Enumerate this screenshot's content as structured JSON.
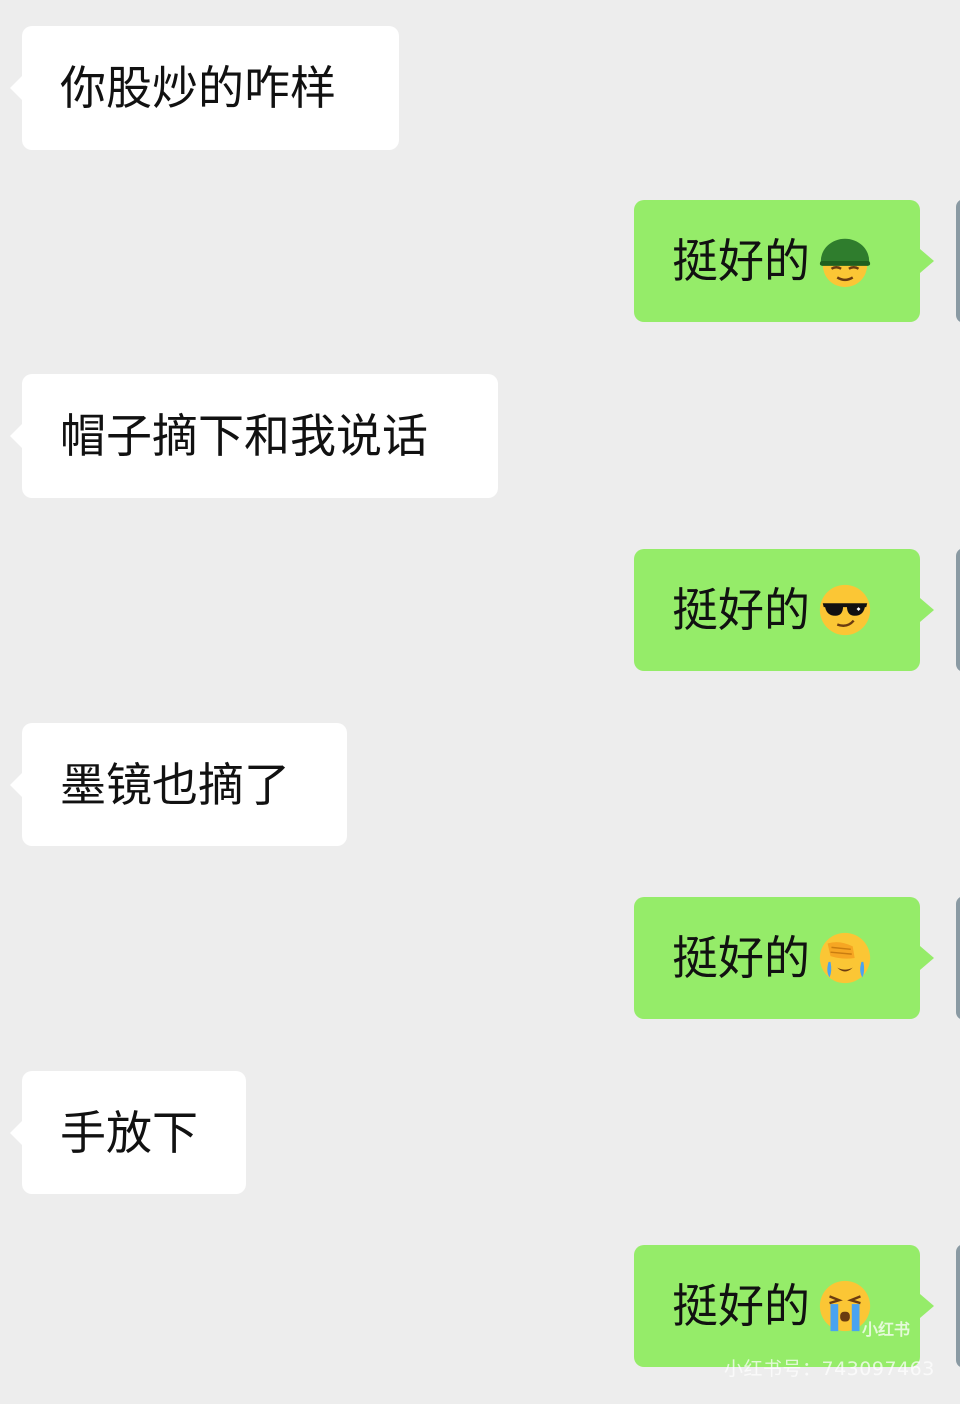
{
  "chat": {
    "messages": [
      {
        "side": "in",
        "text": "你股炒的咋样"
      },
      {
        "side": "out",
        "text": "挺好的",
        "emoji": "helmet-face-icon"
      },
      {
        "side": "in",
        "text": "帽子摘下和我说话"
      },
      {
        "side": "out",
        "text": "挺好的",
        "emoji": "sunglasses-face-icon"
      },
      {
        "side": "in",
        "text": "墨镜也摘了"
      },
      {
        "side": "out",
        "text": "挺好的",
        "emoji": "facepalm-face-icon"
      },
      {
        "side": "in",
        "text": "手放下"
      },
      {
        "side": "out",
        "text": "挺好的",
        "emoji": "crying-face-icon"
      }
    ]
  },
  "watermark": {
    "logo": "小红书",
    "id": "小红书号：743097463"
  },
  "colors": {
    "background": "#ededed",
    "incoming_bubble": "#ffffff",
    "outgoing_bubble": "#95ec69",
    "text": "#111111"
  }
}
